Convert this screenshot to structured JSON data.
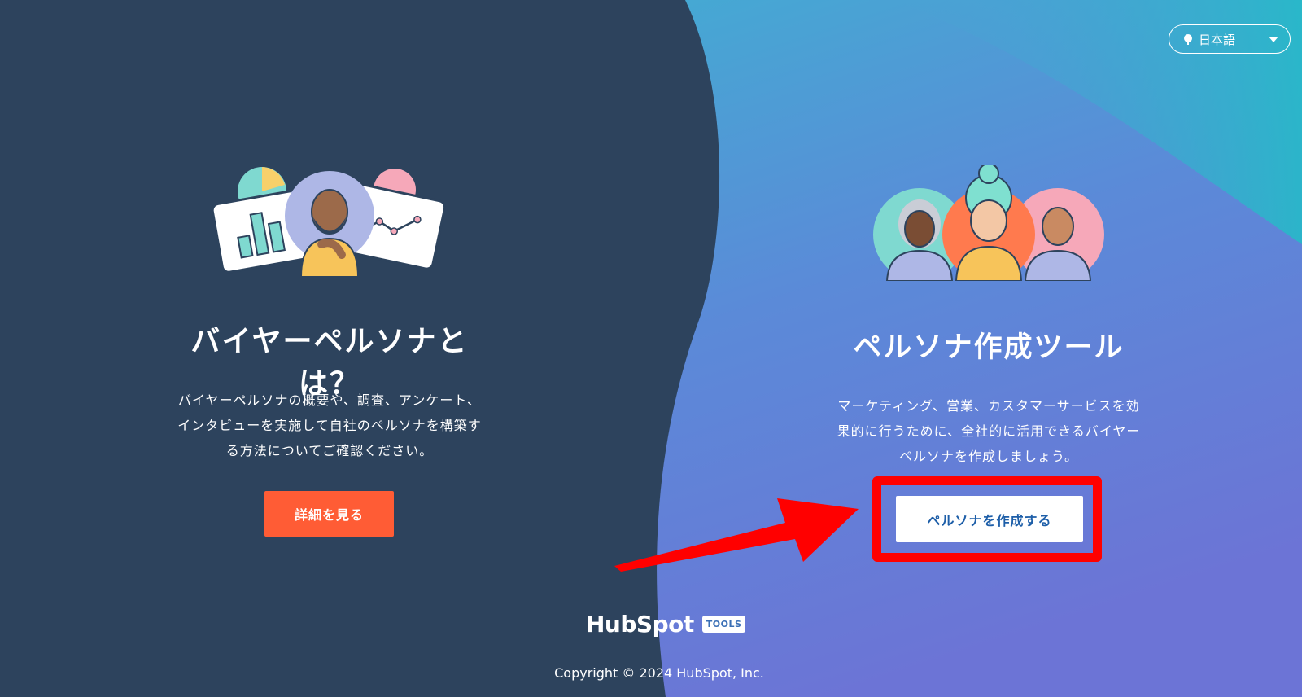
{
  "language_selector": {
    "value": "日本語",
    "icon": "globe-icon"
  },
  "left": {
    "title": "バイヤーペルソナとは？",
    "description_lines": [
      "バイヤーペルソナの概要や、調査、アンケート、",
      "インタビューを実施して自社のペルソナを構築す",
      "る方法についてご確認ください。"
    ],
    "button_label": "詳細を見る",
    "button_color": "#ff5c35"
  },
  "right": {
    "title": "ペルソナ作成ツール",
    "description_lines": [
      "マーケティング、営業、カスタマーサービスを効",
      "果的に行うために、全社的に活用できるバイヤー",
      "ペルソナを作成しましょう。"
    ],
    "button_label": "ペルソナを作成する",
    "highlight_color": "#ff0000"
  },
  "footer": {
    "brand": "HubSpot",
    "tools_badge": "TOOLS",
    "copyright": "Copyright © 2024 HubSpot, Inc."
  },
  "colors": {
    "left_background": "#2d435d",
    "right_gradient_top": "#38b6cf",
    "right_gradient_bottom": "#6b78d6"
  }
}
